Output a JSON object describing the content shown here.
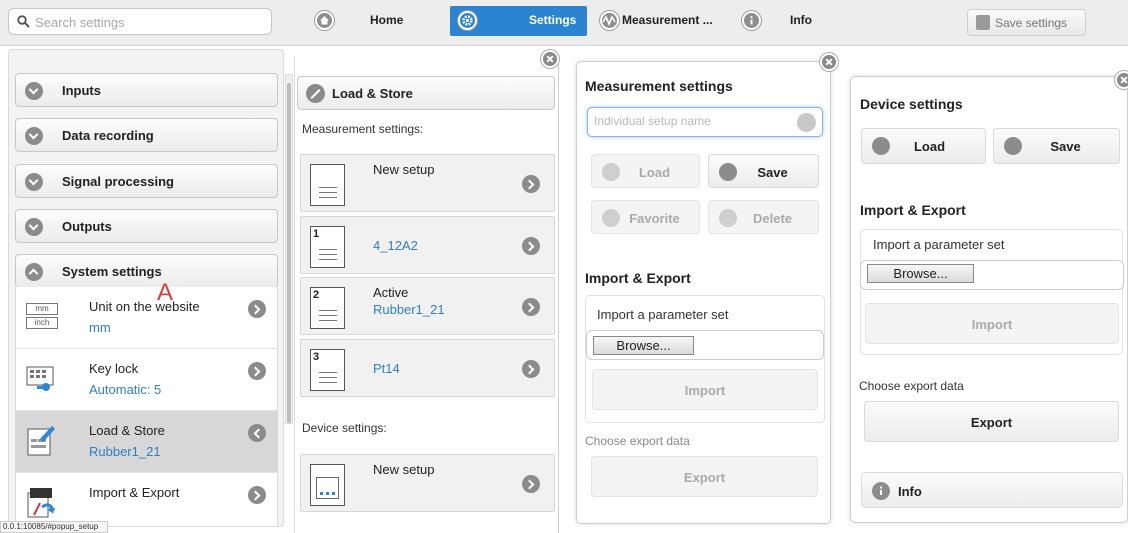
{
  "topbar": {
    "search_placeholder": "Search settings",
    "tabs": [
      {
        "label": "Home",
        "icon": "home-icon"
      },
      {
        "label": "Settings",
        "icon": "gear-icon",
        "active": true
      },
      {
        "label": "Measurement ...",
        "icon": "waveform-icon"
      },
      {
        "label": "Info",
        "icon": "info-icon"
      }
    ],
    "save_label": "Save settings",
    "accent_color": "#2a84d2"
  },
  "sidebar": {
    "sections": [
      {
        "label": "Inputs"
      },
      {
        "label": "Data recording"
      },
      {
        "label": "Signal processing"
      },
      {
        "label": "Outputs"
      },
      {
        "label": "System settings",
        "expanded": true
      }
    ],
    "items": [
      {
        "title": "Unit on the website",
        "value": "mm",
        "thumb": "unit-icon",
        "unit_top": "mm",
        "unit_bottom": "inch"
      },
      {
        "title": "Key lock",
        "value": "Automatic: 5",
        "thumb": "keyboard-key-icon"
      },
      {
        "title": "Load & Store",
        "value": "Rubber1_21",
        "thumb": "document-edit-icon",
        "active": true
      },
      {
        "title": "Import & Export",
        "value": "",
        "thumb": "import-export-icon"
      }
    ]
  },
  "status_url": "0.0.1:10085/#popup_setup",
  "load_store": {
    "title": "Load & Store",
    "measurement_label": "Measurement settings:",
    "setups": [
      {
        "num": "",
        "line1": "New setup",
        "line2": ""
      },
      {
        "num": "1",
        "line1": "",
        "line2": "4_12A2"
      },
      {
        "num": "2",
        "line1": "Active",
        "line2": "Rubber1_21"
      },
      {
        "num": "3",
        "line1": "",
        "line2": "Pt14"
      }
    ],
    "device_label": "Device settings:",
    "device_setups": [
      {
        "line1": "New setup"
      }
    ],
    "marker": "A"
  },
  "measurement_popup": {
    "title": "Measurement settings",
    "name_placeholder": "Individual setup name",
    "load_label": "Load",
    "save_label": "Save",
    "favorite_label": "Favorite",
    "delete_label": "Delete",
    "import_export_title": "Import & Export",
    "import_param_label": "Import a parameter set",
    "browse_label": "Browse...",
    "import_label": "Import",
    "export_data_label": "Choose export data",
    "export_label": "Export"
  },
  "device_popup": {
    "title": "Device settings",
    "load_label": "Load",
    "save_label": "Save",
    "import_export_title": "Import & Export",
    "import_param_label": "Import a parameter set",
    "browse_label": "Browse...",
    "import_label": "Import",
    "export_data_label": "Choose export data",
    "export_label": "Export",
    "info_label": "Info"
  }
}
